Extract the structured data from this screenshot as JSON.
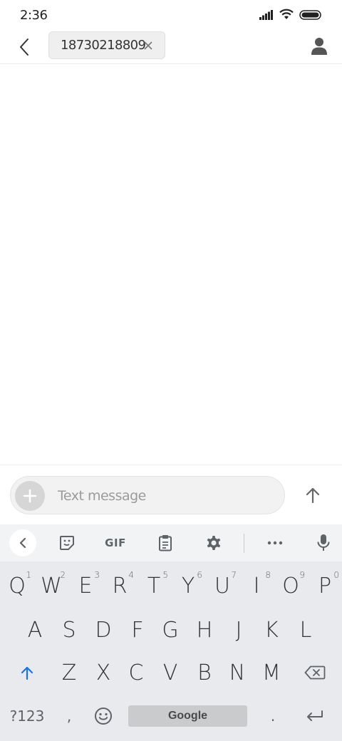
{
  "status_bar": {
    "time": "2:36"
  },
  "header": {
    "recipient": "18730218809"
  },
  "compose": {
    "placeholder": "Text message"
  },
  "keyboard": {
    "toolbar": {
      "gif_label": "GIF"
    },
    "row1": [
      {
        "label": "Q",
        "hint": "1"
      },
      {
        "label": "W",
        "hint": "2"
      },
      {
        "label": "E",
        "hint": "3"
      },
      {
        "label": "R",
        "hint": "4"
      },
      {
        "label": "T",
        "hint": "5"
      },
      {
        "label": "Y",
        "hint": "6"
      },
      {
        "label": "U",
        "hint": "7"
      },
      {
        "label": "I",
        "hint": "8"
      },
      {
        "label": "O",
        "hint": "9"
      },
      {
        "label": "P",
        "hint": "0"
      }
    ],
    "row2": [
      "A",
      "S",
      "D",
      "F",
      "G",
      "H",
      "J",
      "K",
      "L"
    ],
    "row3": [
      "Z",
      "X",
      "C",
      "V",
      "B",
      "N",
      "M"
    ],
    "bottom": {
      "symbols_label": "?123",
      "comma": ",",
      "space_label": "Google",
      "period": "."
    }
  },
  "colors": {
    "accent_shift": "#1a73e8",
    "keyboard_bg": "#e8eaed",
    "toolbar_bg": "#f1f3f4"
  }
}
